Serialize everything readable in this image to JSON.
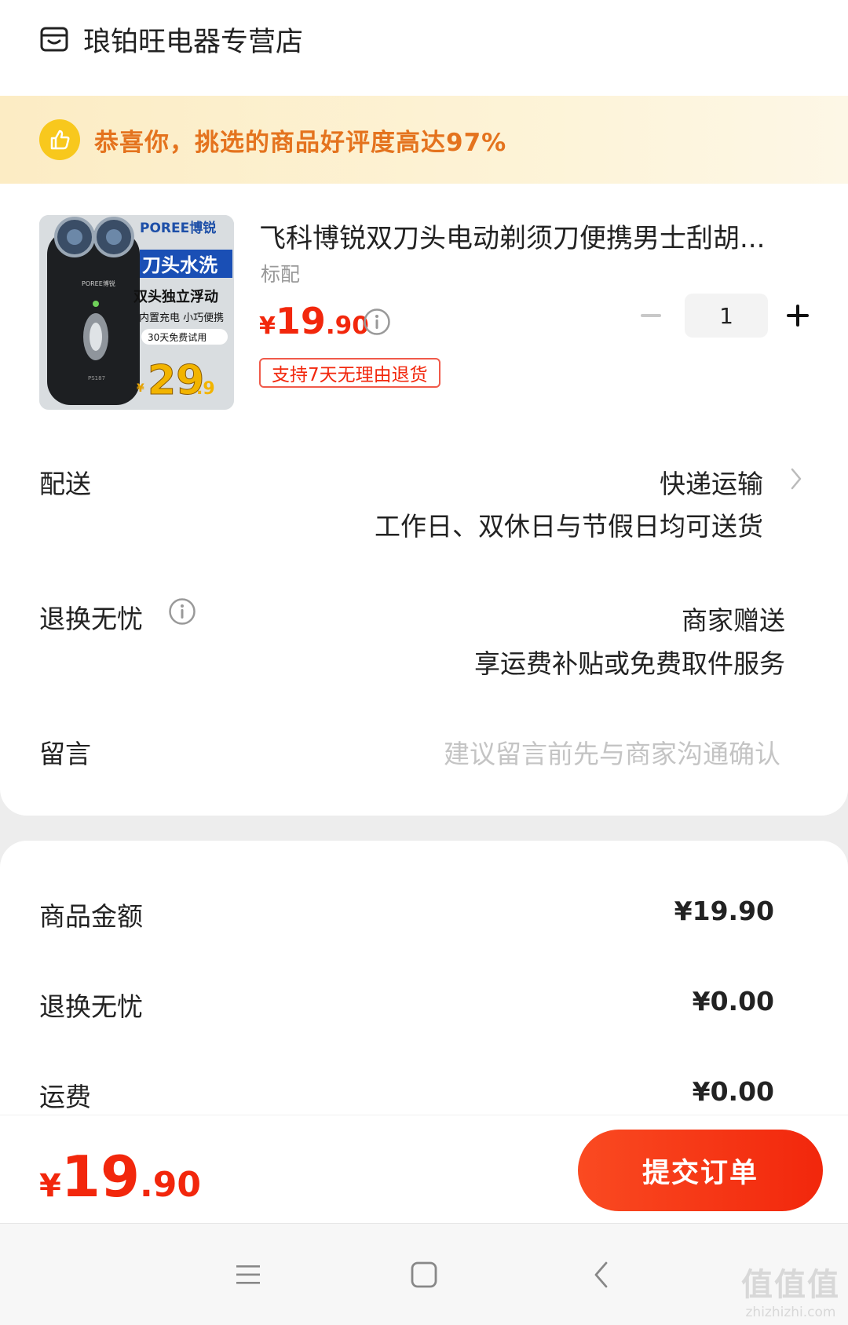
{
  "shop": {
    "name": "琅铂旺电器专营店",
    "icon": "shop-icon"
  },
  "banner": {
    "text": "恭喜你，挑选的商品好评度高达97%",
    "icon": "thumbs-up-icon"
  },
  "product": {
    "title": "飞科博锐双刀头电动剃须刀便携男士刮胡...",
    "spec": "标配",
    "price": {
      "currency": "¥",
      "integer": "19",
      "decimal": ".90"
    },
    "quantity": "1",
    "return_tag": "支持7天无理由退货",
    "image": {
      "brand": "POREE博锐",
      "headline": "刀头水洗",
      "line1": "双头独立浮动",
      "line2": "内置充电 小巧便携",
      "trial": "30天免费试用",
      "price_currency": "¥",
      "price_int": "29",
      "price_dec": ".9",
      "model": "PS187",
      "device_brand": "POREE博锐"
    }
  },
  "delivery": {
    "label": "配送",
    "method": "快递运输",
    "note": "工作日、双休日与节假日均可送货"
  },
  "return_service": {
    "label": "退换无忧",
    "value": "商家赠送",
    "note": "享运费补贴或免费取件服务"
  },
  "message": {
    "label": "留言",
    "placeholder": "建议留言前先与商家沟通确认"
  },
  "summary": [
    {
      "label": "商品金额",
      "value": "¥19.90"
    },
    {
      "label": "退换无忧",
      "value": "¥0.00"
    },
    {
      "label": "运费",
      "value": "¥0.00"
    }
  ],
  "footer": {
    "total": {
      "currency": "¥",
      "integer": "19",
      "decimal": ".90"
    },
    "submit_label": "提交订单"
  },
  "watermark": {
    "main": "值值值",
    "sub": "zhizhizhi.com"
  },
  "colors": {
    "accent": "#f2270c",
    "banner_text": "#e4731e",
    "banner_icon": "#f8c81d"
  }
}
